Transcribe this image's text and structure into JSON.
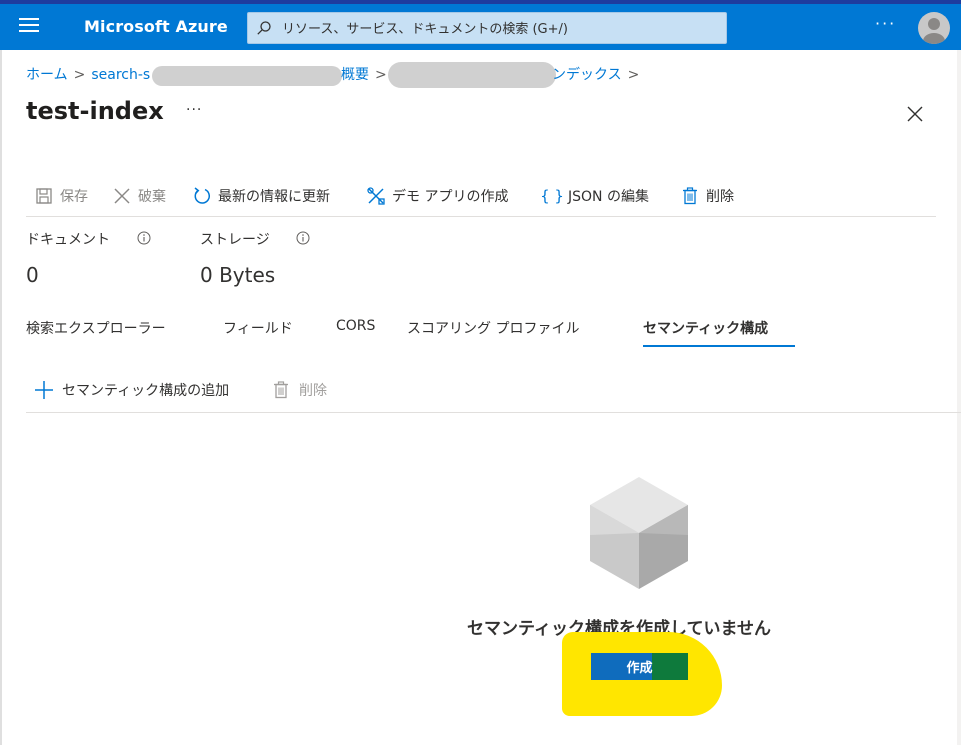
{
  "app": {
    "brand": "Microsoft Azure",
    "search_placeholder": "リソース、サービス、ドキュメントの検索 (G+/)",
    "more": "···"
  },
  "breadcrumb": {
    "home": "ホーム",
    "item2": "search-s",
    "item3": "概要",
    "item4": "ンデックス"
  },
  "page": {
    "title": "test-index",
    "more": "···"
  },
  "commands": {
    "save": "保存",
    "discard": "破棄",
    "refresh": "最新の情報に更新",
    "demo_app": "デモ アプリの作成",
    "edit_json": "JSON の編集",
    "delete": "削除"
  },
  "stats": {
    "documents_label": "ドキュメント",
    "documents_value": "0",
    "storage_label": "ストレージ",
    "storage_value": "0 Bytes"
  },
  "tabs": [
    {
      "label": "検索エクスプローラー"
    },
    {
      "label": "フィールド"
    },
    {
      "label": "CORS"
    },
    {
      "label": "スコアリング プロファイル"
    },
    {
      "label": "セマンティック構成",
      "active": true
    }
  ],
  "subcommands": {
    "add": "セマンティック構成の追加",
    "delete": "削除"
  },
  "empty_state": {
    "message": "セマンティック構成を作成していません",
    "create_label": "作成"
  },
  "colors": {
    "topbar": "#0078d4",
    "accent": "#0078d4",
    "highlight": "#ffe600"
  }
}
